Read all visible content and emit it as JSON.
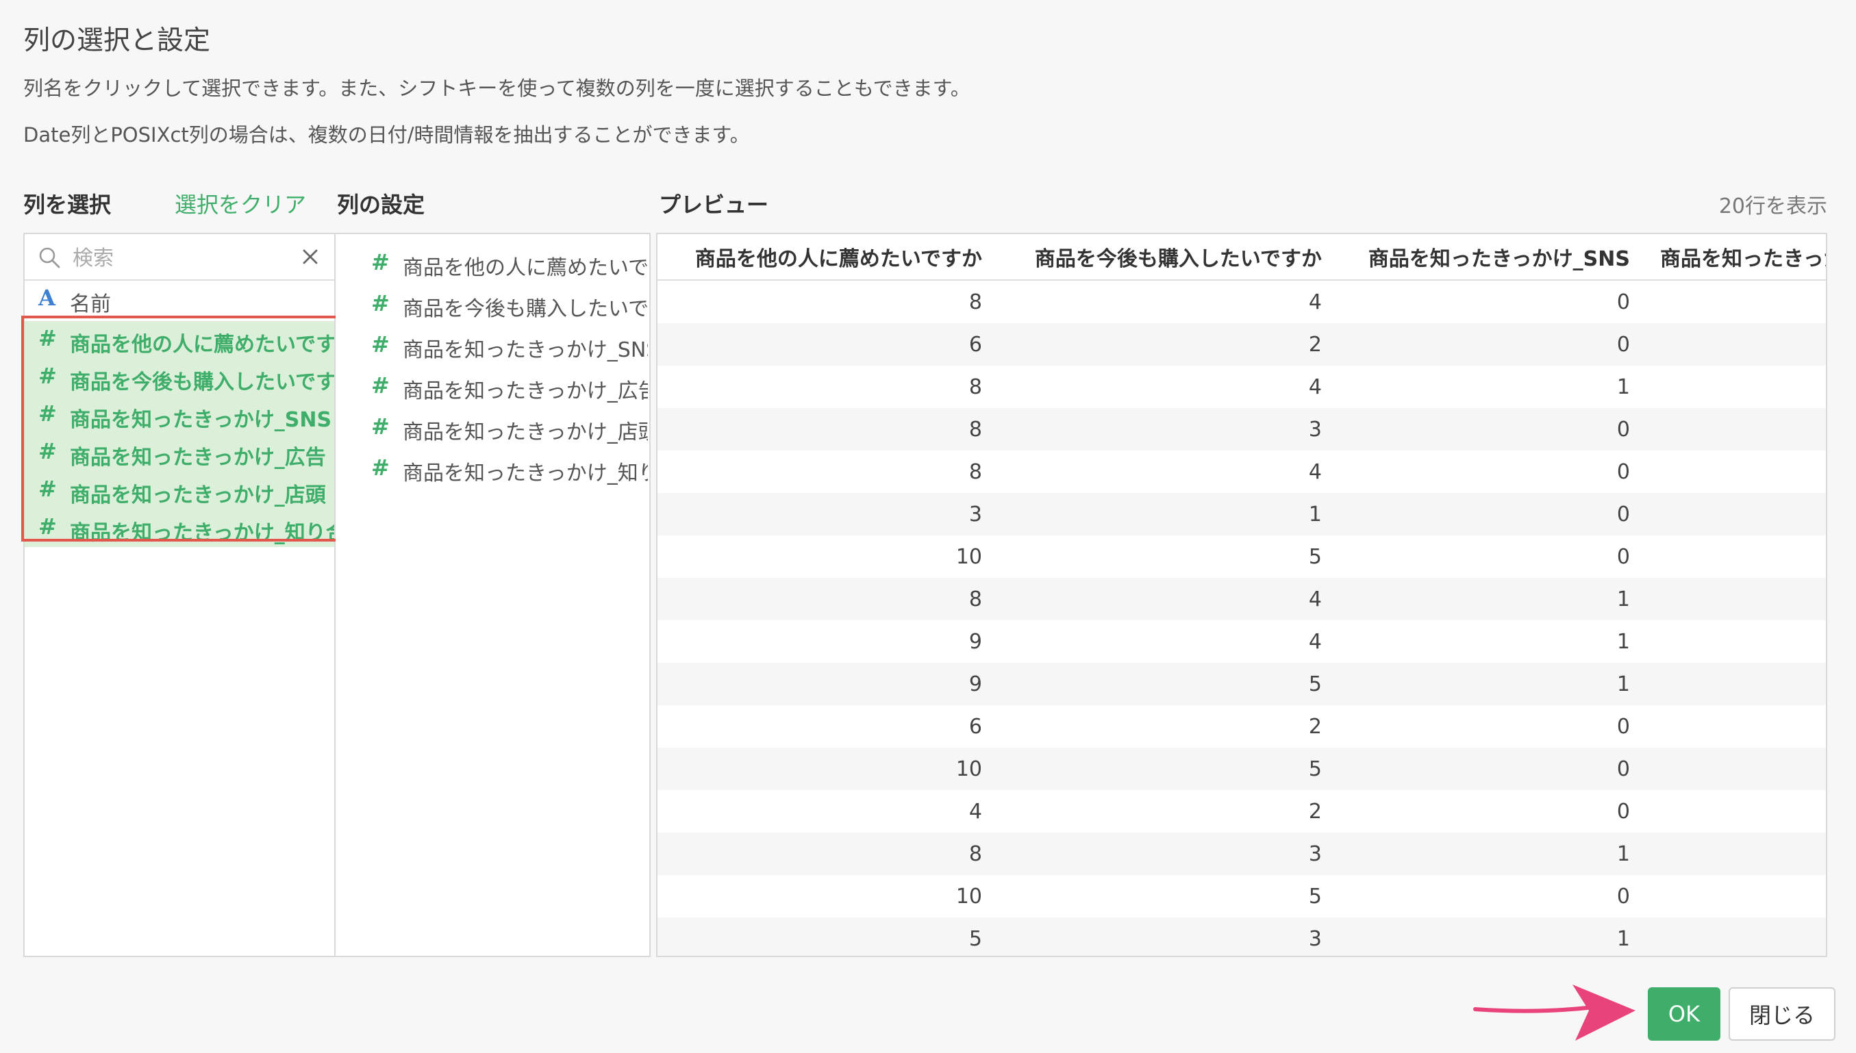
{
  "dialog": {
    "title": "列の選択と設定",
    "desc1": "列名をクリックして選択できます。また、シフトキーを使って複数の列を一度に選択することもできます。",
    "desc2": "Date列とPOSIXct列の場合は、複数の日付/時間情報を抽出することができます。"
  },
  "select_panel": {
    "heading": "列を選択",
    "clear_label": "選択をクリア",
    "search_placeholder": "検索",
    "columns": [
      {
        "type_icon": "A",
        "label": "名前",
        "selected": false
      },
      {
        "type_icon": "#",
        "label": "商品を他の人に薦めたいですか",
        "selected": true
      },
      {
        "type_icon": "#",
        "label": "商品を今後も購入したいですか",
        "selected": true
      },
      {
        "type_icon": "#",
        "label": "商品を知ったきっかけ_SNS",
        "selected": true
      },
      {
        "type_icon": "#",
        "label": "商品を知ったきっかけ_広告",
        "selected": true
      },
      {
        "type_icon": "#",
        "label": "商品を知ったきっかけ_店頭",
        "selected": true
      },
      {
        "type_icon": "#",
        "label": "商品を知ったきっかけ_知り合い",
        "selected": true
      }
    ]
  },
  "settings_panel": {
    "heading": "列の設定",
    "items": [
      {
        "type_icon": "#",
        "label": "商品を他の人に薦めたいですか"
      },
      {
        "type_icon": "#",
        "label": "商品を今後も購入したいですか"
      },
      {
        "type_icon": "#",
        "label": "商品を知ったきっかけ_SNS"
      },
      {
        "type_icon": "#",
        "label": "商品を知ったきっかけ_広告"
      },
      {
        "type_icon": "#",
        "label": "商品を知ったきっかけ_店頭"
      },
      {
        "type_icon": "#",
        "label": "商品を知ったきっかけ_知り合い"
      }
    ]
  },
  "preview": {
    "heading": "プレビュー",
    "rows_note": "20行を表示",
    "columns": [
      "商品を他の人に薦めたいですか",
      "商品を今後も購入したいですか",
      "商品を知ったきっかけ_SNS",
      "商品を知ったきっかけ_広告"
    ],
    "rows": [
      [
        "8",
        "4",
        "0",
        ""
      ],
      [
        "6",
        "2",
        "0",
        ""
      ],
      [
        "8",
        "4",
        "1",
        ""
      ],
      [
        "8",
        "3",
        "0",
        ""
      ],
      [
        "8",
        "4",
        "0",
        ""
      ],
      [
        "3",
        "1",
        "0",
        ""
      ],
      [
        "10",
        "5",
        "0",
        ""
      ],
      [
        "8",
        "4",
        "1",
        ""
      ],
      [
        "9",
        "4",
        "1",
        ""
      ],
      [
        "9",
        "5",
        "1",
        ""
      ],
      [
        "6",
        "2",
        "0",
        ""
      ],
      [
        "10",
        "5",
        "0",
        ""
      ],
      [
        "4",
        "2",
        "0",
        ""
      ],
      [
        "8",
        "3",
        "1",
        ""
      ],
      [
        "10",
        "5",
        "0",
        ""
      ],
      [
        "5",
        "3",
        "1",
        ""
      ]
    ]
  },
  "footer": {
    "ok_label": "OK",
    "close_label": "閉じる"
  },
  "colors": {
    "accent_green": "#3fae6a",
    "selection_bg": "#dcefd9",
    "highlight_red": "#e2574c",
    "arrow_pink": "#e8437a"
  }
}
